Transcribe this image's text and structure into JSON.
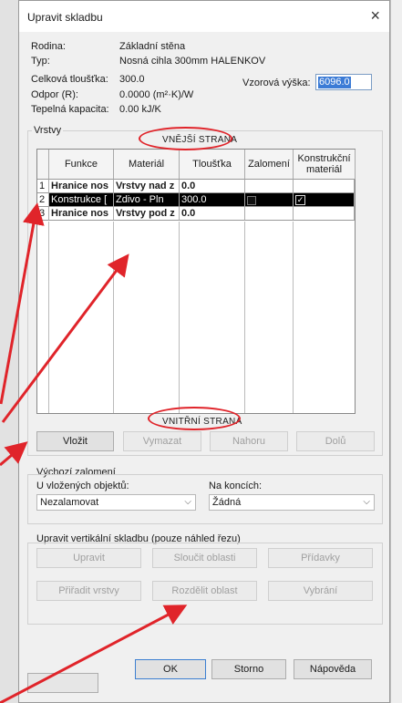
{
  "background": {
    "left_strip_color": "#e2e2e2",
    "right_strip_color": "#efefef"
  },
  "dialog": {
    "title": "Upravit skladbu",
    "close_glyph": "×"
  },
  "properties": {
    "rows": [
      {
        "label": "Rodina:",
        "value": "Základní stěna"
      },
      {
        "label": "Typ:",
        "value": "Nosná cihla 300mm HALENKOV"
      },
      {
        "label": "Celková tloušťka:",
        "value": "300.0"
      },
      {
        "label": "Odpor (R):",
        "value": "0.0000 (m²·K)/W"
      },
      {
        "label": "Tepelná kapacita:",
        "value": "0.00 kJ/K"
      }
    ],
    "sample_height_label": "Vzorová výška:",
    "sample_height_value": "6096.0"
  },
  "layers": {
    "group_label": "Vrstvy",
    "exterior_callout": "VNĚJŠÍ STRANA",
    "interior_callout": "VNITŘNÍ STRANA",
    "columns": [
      "Funkce",
      "Materiál",
      "Tloušťka",
      "Zalomení",
      "Konstrukční materiál"
    ],
    "rows": [
      {
        "num": "1",
        "funkce": "Hranice nos",
        "material": "Vrstvy nad z",
        "tloustka": "0.0",
        "zalomeni": false,
        "konstrukcni": false,
        "bold": true,
        "selected": false
      },
      {
        "num": "2",
        "funkce": "Konstrukce [",
        "material": "Zdivo - Pln",
        "tloustka": "300.0",
        "zalomeni": true,
        "konstrukcni": true,
        "bold": false,
        "selected": true
      },
      {
        "num": "3",
        "funkce": "Hranice nos",
        "material": "Vrstvy pod z",
        "tloustka": "0.0",
        "zalomeni": false,
        "konstrukcni": false,
        "bold": true,
        "selected": false
      }
    ]
  },
  "layer_buttons": {
    "insert": "Vložit",
    "delete": "Vymazat",
    "up": "Nahoru",
    "down": "Dolů"
  },
  "wrapping": {
    "group_label": "Výchozí zalomení",
    "inserts_label": "U vložených objektů:",
    "inserts_value": "Nezalamovat",
    "ends_label": "Na koncích:",
    "ends_value": "Žádná"
  },
  "vertical": {
    "group_label": "Upravit vertikální skladbu (pouze náhled řezu)",
    "buttons": {
      "modify": "Upravit",
      "merge": "Sloučit oblasti",
      "sweeps": "Přídavky",
      "assign": "Přiřadit vrstvy",
      "split": "Rozdělit oblast",
      "reveals": "Vybrání"
    }
  },
  "footer": {
    "ok": "OK",
    "cancel": "Storno",
    "help": "Nápověda"
  },
  "annotation": {
    "color": "#e0242a"
  }
}
